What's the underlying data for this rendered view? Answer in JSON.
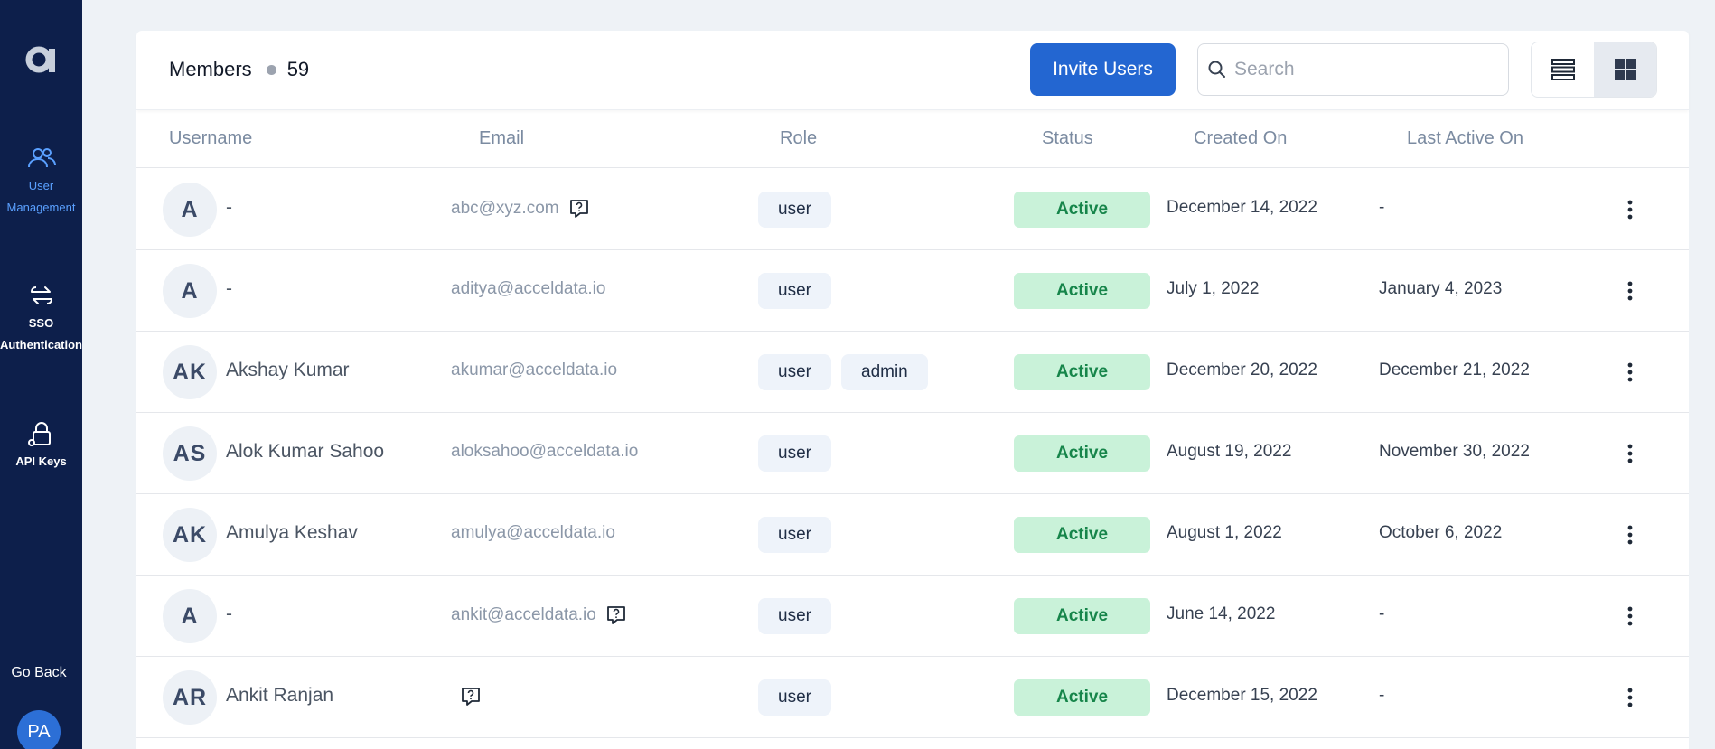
{
  "sidebar": {
    "logo": "a",
    "items": [
      {
        "label_line1": "User",
        "label_line2": "Management",
        "icon": "users-icon",
        "active": true
      },
      {
        "label_line1": "SSO",
        "label_line2": "Authentication",
        "icon": "sso-arrows-icon",
        "active": false
      },
      {
        "label_line1": "API Keys",
        "label_line2": "",
        "icon": "key-lock-icon",
        "active": false
      }
    ],
    "go_back": "Go Back",
    "user_initials": "PA"
  },
  "header": {
    "title": "Members",
    "count": "59",
    "invite_label": "Invite Users",
    "search_placeholder": "Search"
  },
  "table": {
    "columns": [
      "Username",
      "Email",
      "Role",
      "Status",
      "Created On",
      "Last Active On"
    ],
    "rows": [
      {
        "initials": "A",
        "name": "-",
        "email": "abc@xyz.com",
        "email_icon": true,
        "roles": [
          "user"
        ],
        "status": "Active",
        "created": "December 14, 2022",
        "last_active": "-"
      },
      {
        "initials": "A",
        "name": "-",
        "email": "aditya@acceldata.io",
        "email_icon": false,
        "roles": [
          "user"
        ],
        "status": "Active",
        "created": "July 1, 2022",
        "last_active": "January 4, 2023"
      },
      {
        "initials": "AK",
        "name": "Akshay Kumar",
        "email": "akumar@acceldata.io",
        "email_icon": false,
        "roles": [
          "user",
          "admin"
        ],
        "status": "Active",
        "created": "December 20, 2022",
        "last_active": "December 21, 2022"
      },
      {
        "initials": "AS",
        "name": "Alok Kumar Sahoo",
        "email": "aloksahoo@acceldata.io",
        "email_icon": false,
        "roles": [
          "user"
        ],
        "status": "Active",
        "created": "August 19, 2022",
        "last_active": "November 30, 2022"
      },
      {
        "initials": "AK",
        "name": "Amulya Keshav",
        "email": "amulya@acceldata.io",
        "email_icon": false,
        "roles": [
          "user"
        ],
        "status": "Active",
        "created": "August 1, 2022",
        "last_active": "October 6, 2022"
      },
      {
        "initials": "A",
        "name": "-",
        "email": "ankit@acceldata.io",
        "email_icon": true,
        "roles": [
          "user"
        ],
        "status": "Active",
        "created": "June 14, 2022",
        "last_active": "-"
      },
      {
        "initials": "AR",
        "name": "Ankit Ranjan",
        "email": "",
        "email_icon": true,
        "roles": [
          "user"
        ],
        "status": "Active",
        "created": "December 15, 2022",
        "last_active": "-"
      }
    ]
  },
  "colors": {
    "sidebar_bg": "#0d1f4b",
    "accent": "#2366d1",
    "active_nav": "#5aa0ff",
    "status_bg": "#c9f2d9",
    "status_text": "#16854a"
  }
}
